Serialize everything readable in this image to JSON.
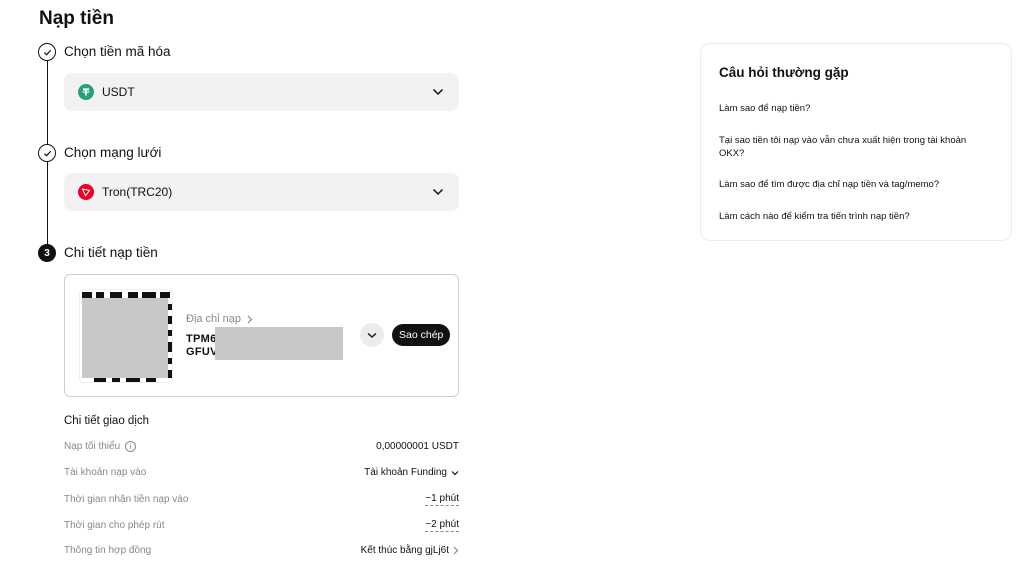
{
  "page": {
    "title": "Nạp tiền"
  },
  "steps": [
    {
      "number": "1",
      "label": "Chọn tiền mã hóa",
      "status": "done"
    },
    {
      "number": "2",
      "label": "Chọn mạng lưới",
      "status": "done"
    },
    {
      "number": "3",
      "label": "Chi tiết nạp tiền",
      "status": "active"
    }
  ],
  "coin_select": {
    "value": "USDT",
    "icon": "tether-icon",
    "icon_color": "#26a17b"
  },
  "network_select": {
    "value": "Tron(TRC20)",
    "icon": "tron-icon",
    "icon_color": "#eb0029"
  },
  "deposit": {
    "address_label": "Địa chỉ nạp",
    "address_line1": "TPM6",
    "address_line2": "GFUV",
    "copy_label": "Sao chép"
  },
  "details": {
    "title": "Chi tiết giao dịch",
    "rows": [
      {
        "label": "Nạp tối thiểu",
        "value": "0,00000001 USDT"
      },
      {
        "label": "Tài khoản nạp vào",
        "value": "Tài khoản Funding"
      },
      {
        "label": "Thời gian nhận tiền nạp vào",
        "value": "~1 phút"
      },
      {
        "label": "Thời gian cho phép rút",
        "value": "~2 phút"
      },
      {
        "label": "Thông tin hợp đồng",
        "value": "Kết thúc bằng gjLj6t"
      }
    ]
  },
  "faq": {
    "title": "Câu hỏi thường gặp",
    "items": [
      "Làm sao để nạp tiền?",
      "Tại sao tiền tôi nạp vào vẫn chưa xuất hiện trong tài khoản OKX?",
      "Làm sao để tìm được địa chỉ nạp tiền và tag/memo?",
      "Làm cách nào để kiểm tra tiến trình nạp tiền?"
    ]
  },
  "colors": {
    "accent": "#111111",
    "muted": "#888888",
    "field_bg": "#f2f2f2"
  }
}
